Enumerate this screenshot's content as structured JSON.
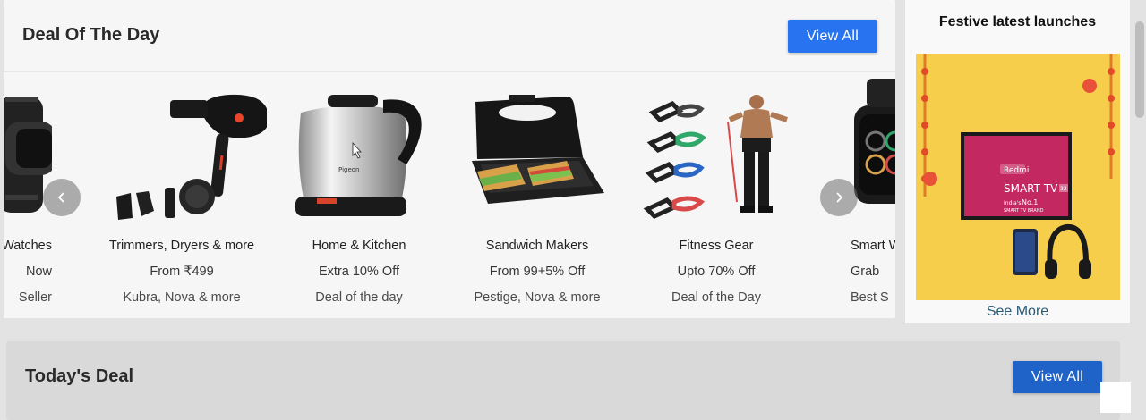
{
  "deal_of_the_day": {
    "title": "Deal Of The Day",
    "view_all_label": "View All",
    "products": [
      {
        "name": "Watches",
        "offer": "Now",
        "tag": "Seller",
        "image": "smart-watch-strap-image"
      },
      {
        "name": "Trimmers, Dryers & more",
        "offer": "From ₹499",
        "tag": "Kubra, Nova & more",
        "image": "hair-dryer-image"
      },
      {
        "name": "Home & Kitchen",
        "offer": "Extra 10% Off",
        "tag": "Deal of the day",
        "image": "electric-kettle-image"
      },
      {
        "name": "Sandwich Makers",
        "offer": "From 99+5% Off",
        "tag": "Pestige, Nova & more",
        "image": "sandwich-maker-image"
      },
      {
        "name": "Fitness Gear",
        "offer": "Upto 70% Off",
        "tag": "Deal of the Day",
        "image": "resistance-bands-image"
      },
      {
        "name": "Smart W",
        "offer": "Grab",
        "tag": "Best S",
        "image": "smart-watch-image"
      }
    ],
    "prev_icon": "chevron-left-icon",
    "next_icon": "chevron-right-icon"
  },
  "festive": {
    "title": "Festive latest launches",
    "banner": {
      "brand": "Redmi",
      "product": "SMART TV",
      "size": "32",
      "claim_prefix": "India's",
      "claim_highlight": "No.1",
      "claim_sub": "SMART TV BRAND"
    },
    "see_more_label": "See More"
  },
  "todays_deal": {
    "title": "Today's Deal",
    "view_all_label": "View All"
  },
  "colors": {
    "accent": "#2874f0",
    "link": "#2a5b76",
    "banner_bg": "#f4c93d",
    "page_bg": "#e3e3e3"
  }
}
